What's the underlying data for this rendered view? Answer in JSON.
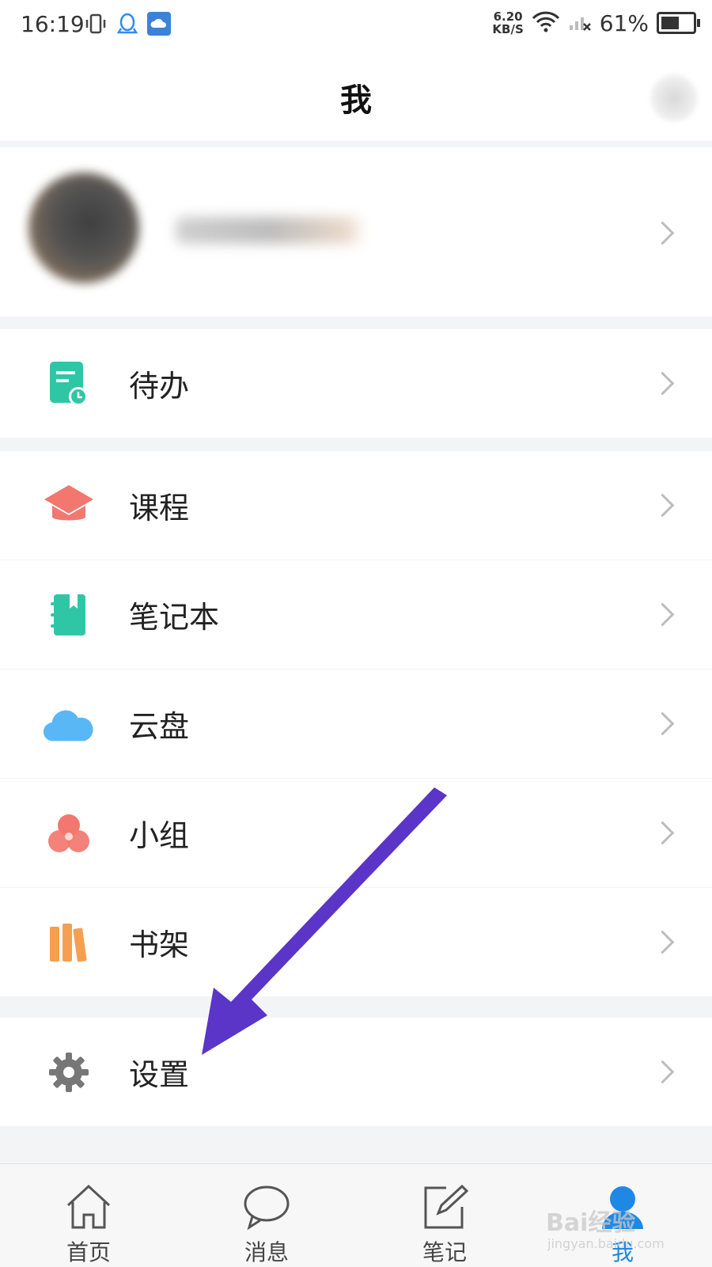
{
  "status_bar": {
    "time": "16:19",
    "net_speed_value": "6.20",
    "net_speed_unit": "KB/S",
    "battery": "61%",
    "battery_level": 0.61
  },
  "header": {
    "title": "我"
  },
  "profile": {
    "name": ""
  },
  "menu": {
    "todo": "待办",
    "courses": "课程",
    "notebook": "笔记本",
    "cloud": "云盘",
    "groups": "小组",
    "bookshelf": "书架",
    "settings": "设置"
  },
  "tabbar": {
    "home": "首页",
    "messages": "消息",
    "notes": "笔记",
    "me": "我",
    "active_color": "#1e88e5"
  },
  "watermark": {
    "brand": "Bai经验",
    "url": "jingyan.baidu.com"
  },
  "colors": {
    "todo_icon": "#2fc6a6",
    "courses_icon": "#f2776f",
    "notebook_icon": "#2fc6a6",
    "cloud_icon": "#59b7f5",
    "groups_icon": "#f2776f",
    "bookshelf_icon": "#f5a050",
    "settings_icon": "#777777",
    "annotation_arrow": "#5a35c8"
  }
}
